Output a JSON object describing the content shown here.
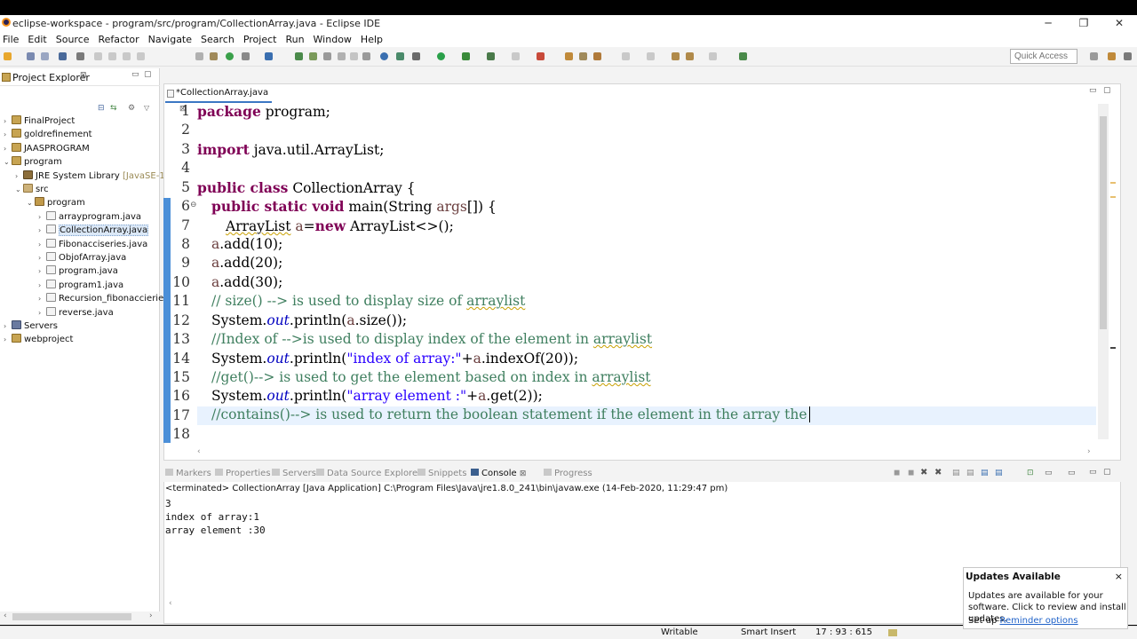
{
  "window": {
    "title": "eclipse-workspace - program/src/program/CollectionArray.java - Eclipse IDE",
    "controls": [
      "─",
      "❐",
      "✕"
    ]
  },
  "menu": [
    "File",
    "Edit",
    "Source",
    "Refactor",
    "Navigate",
    "Search",
    "Project",
    "Run",
    "Window",
    "Help"
  ],
  "toolbar": {
    "quick_access_placeholder": "Quick Access"
  },
  "explorer": {
    "title": "Project Explorer",
    "tree": [
      {
        "label": "FinalProject",
        "icon": "project-icon"
      },
      {
        "label": "goldrefinement",
        "icon": "project-icon"
      },
      {
        "label": "JAASPROGRAM",
        "icon": "project-icon"
      },
      {
        "label": "program",
        "icon": "project-icon"
      },
      {
        "label": "JRE System Library",
        "suffix": "[JavaSE-1.8",
        "icon": "library-icon"
      },
      {
        "label": "src",
        "icon": "source-folder-icon"
      },
      {
        "label": "program",
        "icon": "package-icon"
      },
      {
        "label": "arrayprogram.java",
        "icon": "java-file-icon"
      },
      {
        "label": "CollectionArray.java",
        "icon": "java-file-icon"
      },
      {
        "label": "Fibonacciseries.java",
        "icon": "java-file-icon"
      },
      {
        "label": "ObjofArray.java",
        "icon": "java-file-icon"
      },
      {
        "label": "program.java",
        "icon": "java-file-icon"
      },
      {
        "label": "program1.java",
        "icon": "java-file-icon"
      },
      {
        "label": "Recursion_fibonaccierie",
        "icon": "java-file-icon"
      },
      {
        "label": "reverse.java",
        "icon": "java-file-icon"
      },
      {
        "label": "Servers",
        "icon": "servers-icon"
      },
      {
        "label": "webproject",
        "icon": "project-icon"
      }
    ]
  },
  "editor": {
    "tab_label": "*CollectionArray.java",
    "lines": [
      "1",
      "2",
      "3",
      "4",
      "5",
      "6",
      "7",
      "8",
      "9",
      "10",
      "11",
      "12",
      "13",
      "14",
      "15",
      "16",
      "17",
      "18"
    ],
    "code": {
      "l1_kw": "package",
      "l1_rest": " program;",
      "l3_kw": "import",
      "l3_rest": " java.util.ArrayList;",
      "l5_kw": "public class",
      "l5_rest": " CollectionArray {",
      "l6_kw": "public static void",
      "l6_rest": " main(String ",
      "l6_var": "args",
      "l6_end": "[]) {",
      "l7_type": "ArrayList",
      "l7_sp": " ",
      "l7_var": "a",
      "l7_eq": "=",
      "l7_kw": "new",
      "l7_rest": " ArrayList<>();",
      "l8_var": "a",
      "l8_rest": ".add(10);",
      "l9_var": "a",
      "l9_rest": ".add(20);",
      "l10_var": "a",
      "l10_rest": ".add(30);",
      "l11_a": "// size() --> is used to display size of ",
      "l11_b": "arraylist",
      "l12_a": "System.",
      "l12_it": "out",
      "l12_b": ".println(",
      "l12_var": "a",
      "l12_c": ".size());",
      "l13_a": "//Index of -->is used to display index of the element in ",
      "l13_b": "arraylist",
      "l14_a": "System.",
      "l14_it": "out",
      "l14_b": ".println(",
      "l14_st": "\"index of array:\"",
      "l14_c": "+",
      "l14_var": "a",
      "l14_d": ".indexOf(20));",
      "l15_a": "//get()--> is used to get the element based on index in ",
      "l15_b": "arraylist",
      "l16_a": "System.",
      "l16_it": "out",
      "l16_b": ".println(",
      "l16_st": "\"array element :\"",
      "l16_c": "+",
      "l16_var": "a",
      "l16_d": ".get(2));",
      "l17": "//contains()--> is used to return the boolean statement if the element in the array the "
    }
  },
  "console": {
    "tabs": [
      "Markers",
      "Properties",
      "Servers",
      "Data Source Explorer",
      "Snippets",
      "Console",
      "Progress"
    ],
    "active_tab": "Console",
    "description": "<terminated> CollectionArray [Java Application] C:\\Program Files\\Java\\jre1.8.0_241\\bin\\javaw.exe (14-Feb-2020, 11:29:47 pm)",
    "output": [
      "3",
      "index of array:1",
      "array element :30"
    ]
  },
  "status": {
    "writable": "Writable",
    "insert_mode": "Smart Insert",
    "position": "17 : 93 : 615"
  },
  "popup": {
    "title": "Updates Available",
    "close": "×",
    "message": "Updates are available for your software. Click to review and install updates.",
    "link_prefix": "Set up ",
    "link": "Reminder options"
  }
}
